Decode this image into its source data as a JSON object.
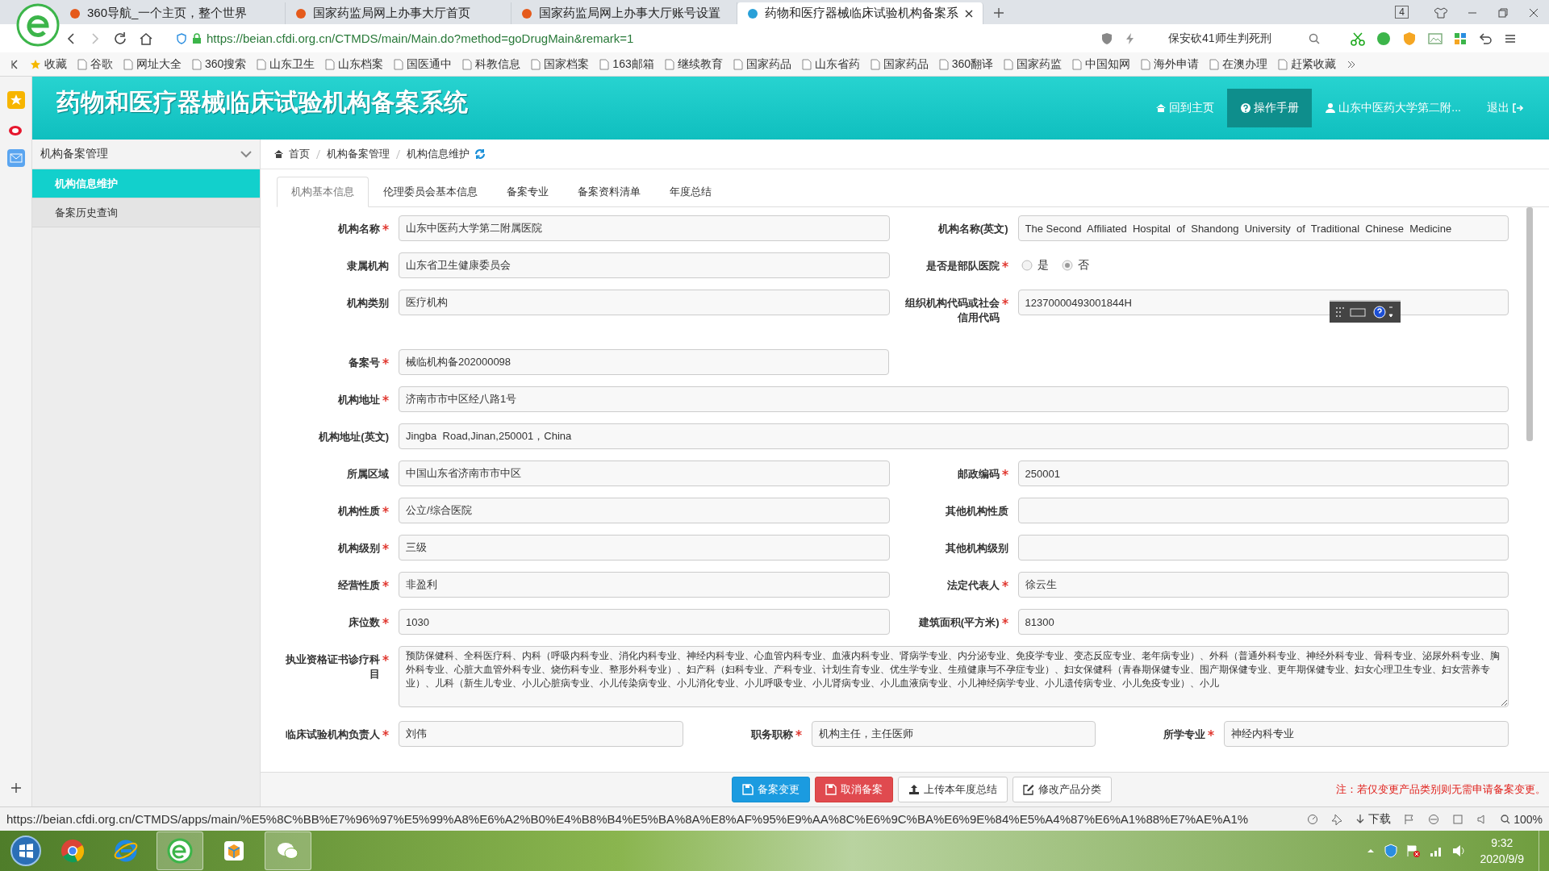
{
  "browser": {
    "tabs": [
      {
        "title": "360导航_一个主页，整个世界",
        "selected": false
      },
      {
        "title": "国家药监局网上办事大厅首页",
        "selected": false
      },
      {
        "title": "国家药监局网上办事大厅账号设置",
        "selected": false
      },
      {
        "title": "药物和医疗器械临床试验机构备案系",
        "selected": true
      }
    ],
    "tab_count": "4",
    "address": "https://beian.cfdi.org.cn/CTMDS/main/Main.do?method=goDrugMain&remark=1",
    "search": "保安砍41师生判死刑",
    "bookmarks": [
      "收藏",
      "谷歌",
      "网址大全",
      "360搜索",
      "山东卫生",
      "山东档案",
      "国医通中",
      "科教信息",
      "国家档案",
      "163邮箱",
      "继续教育",
      "国家药品",
      "山东省药",
      "国家药品",
      "360翻译",
      "国家药监",
      "中国知网",
      "海外申请",
      "在澳办理",
      "赶紧收藏"
    ]
  },
  "header": {
    "title": "药物和医疗器械临床试验机构备案系统",
    "nav": [
      {
        "label": "回到主页",
        "kind": "home",
        "selected": false
      },
      {
        "label": "操作手册",
        "kind": "help",
        "selected": true
      },
      {
        "label": "山东中医药大学第二附...",
        "kind": "user",
        "selected": false
      },
      {
        "label": "退出",
        "kind": "logout",
        "selected": false
      }
    ]
  },
  "sidebar": {
    "groups": [
      {
        "label": "机构备案管理",
        "expanded": true,
        "children": [
          {
            "label": "机构信息维护",
            "selected": true
          },
          {
            "label": "备案历史查询",
            "selected": false
          }
        ]
      }
    ]
  },
  "breadcrumb": [
    "首页",
    "机构备案管理",
    "机构信息维护"
  ],
  "tabs": [
    {
      "label": "机构基本信息",
      "selected": true
    },
    {
      "label": "伦理委员会基本信息",
      "selected": false
    },
    {
      "label": "备案专业",
      "selected": false
    },
    {
      "label": "备案资料清单",
      "selected": false
    },
    {
      "label": "年度总结",
      "selected": false
    }
  ],
  "form": {
    "rows": [
      {
        "kind": "pair",
        "fields": [
          {
            "kind": "text",
            "label": "机构名称",
            "required": true,
            "value": "山东中医药大学第二附属医院"
          },
          {
            "kind": "text",
            "label": "机构名称(英文)",
            "required": false,
            "value": "The Second  Affiliated  Hospital  of  Shandong  University  of  Traditional  Chinese  Medicine"
          }
        ]
      },
      {
        "kind": "pair",
        "fields": [
          {
            "kind": "text",
            "label": "隶属机构",
            "required": false,
            "value": "山东省卫生健康委员会"
          },
          {
            "kind": "radio",
            "label": "是否是部队医院",
            "required": true,
            "options": [
              {
                "label": "是",
                "selected": false
              },
              {
                "label": "否",
                "selected": true
              }
            ]
          }
        ]
      },
      {
        "kind": "pair",
        "fields": [
          {
            "kind": "text",
            "label": "机构类别",
            "required": false,
            "value": "医疗机构"
          },
          {
            "kind": "text",
            "label": "组织机构代码或社会信用代码",
            "required": true,
            "value": "12370000493001844H"
          }
        ]
      },
      {
        "kind": "half",
        "fields": [
          {
            "kind": "text",
            "label": "备案号",
            "required": true,
            "value": "械临机构备202000098"
          }
        ]
      },
      {
        "kind": "full",
        "fields": [
          {
            "kind": "text",
            "label": "机构地址",
            "required": true,
            "value": "济南市市中区经八路1号"
          }
        ]
      },
      {
        "kind": "full",
        "fields": [
          {
            "kind": "text",
            "label": "机构地址(英文)",
            "required": false,
            "value": "Jingba  Road,Jinan,250001，China"
          }
        ]
      },
      {
        "kind": "pair",
        "fields": [
          {
            "kind": "text",
            "label": "所属区域",
            "required": false,
            "value": "中国山东省济南市市中区"
          },
          {
            "kind": "text",
            "label": "邮政编码",
            "required": true,
            "value": "250001"
          }
        ]
      },
      {
        "kind": "pair",
        "fields": [
          {
            "kind": "text",
            "label": "机构性质",
            "required": true,
            "value": "公立/综合医院"
          },
          {
            "kind": "text",
            "label": "其他机构性质",
            "required": false
          }
        ]
      },
      {
        "kind": "pair",
        "fields": [
          {
            "kind": "text",
            "label": "机构级别",
            "required": true,
            "value": "三级"
          },
          {
            "kind": "text",
            "label": "其他机构级别",
            "required": false
          }
        ]
      },
      {
        "kind": "pair",
        "fields": [
          {
            "kind": "text",
            "label": "经营性质",
            "required": true,
            "value": "非盈利"
          },
          {
            "kind": "text",
            "label": "法定代表人",
            "required": true,
            "value": "徐云生"
          }
        ]
      },
      {
        "kind": "pair",
        "fields": [
          {
            "kind": "text",
            "label": "床位数",
            "required": true,
            "value": "1030"
          },
          {
            "kind": "text",
            "label": "建筑面积(平方米)",
            "required": true,
            "value": "81300"
          }
        ]
      },
      {
        "kind": "full",
        "fields": [
          {
            "kind": "textarea",
            "label": "执业资格证书诊疗科目",
            "required": true,
            "value": "预防保健科、全科医疗科、内科（呼吸内科专业、消化内科专业、神经内科专业、心血管内科专业、血液内科专业、肾病学专业、内分泌专业、免疫学专业、变态反应专业、老年病专业）、外科（普通外科专业、神经外科专业、骨科专业、泌尿外科专业、胸外科专业、心脏大血管外科专业、烧伤科专业、整形外科专业）、妇产科（妇科专业、产科专业、计划生育专业、优生学专业、生殖健康与不孕症专业）、妇女保健科（青春期保健专业、围产期保健专业、更年期保健专业、妇女心理卫生专业、妇女营养专业）、儿科（新生儿专业、小儿心脏病专业、小儿传染病专业、小儿消化专业、小儿呼吸专业、小儿肾病专业、小儿血液病专业、小儿神经病学专业、小儿遗传病专业、小儿免疫专业）、小儿"
          }
        ]
      },
      {
        "kind": "triple",
        "fields": [
          {
            "kind": "text",
            "label": "临床试验机构负责人",
            "required": true,
            "value": "刘伟"
          },
          {
            "kind": "text",
            "label": "职务职称",
            "required": true,
            "value": "机构主任，主任医师"
          },
          {
            "kind": "text",
            "label": "所学专业",
            "required": true,
            "value": "神经内科专业"
          }
        ]
      }
    ]
  },
  "actions": [
    {
      "label": "备案变更",
      "kind": "primary"
    },
    {
      "label": "取消备案",
      "kind": "danger"
    },
    {
      "label": "上传本年度总结",
      "kind": "upload"
    },
    {
      "label": "修改产品分类",
      "kind": "edit"
    }
  ],
  "note": "注：若仅变更产品类别则无需申请备案变更。",
  "status_bar": {
    "url": "https://beian.cfdi.org.cn/CTMDS/apps/main/%E5%8C%BB%E7%96%97%E5%99%A8%E6%A2%B0%E4%B8%B4%E5%BA%8A%E8%AF%95%E9%AA%8C%E6%9C%BA%E6%9E%84%E5%A4%87%E6%A1%88%E7%AE%A1%",
    "download": "下载",
    "zoom": "100%"
  },
  "taskbar": {
    "time": "9:32",
    "date": "2020/9/9"
  }
}
